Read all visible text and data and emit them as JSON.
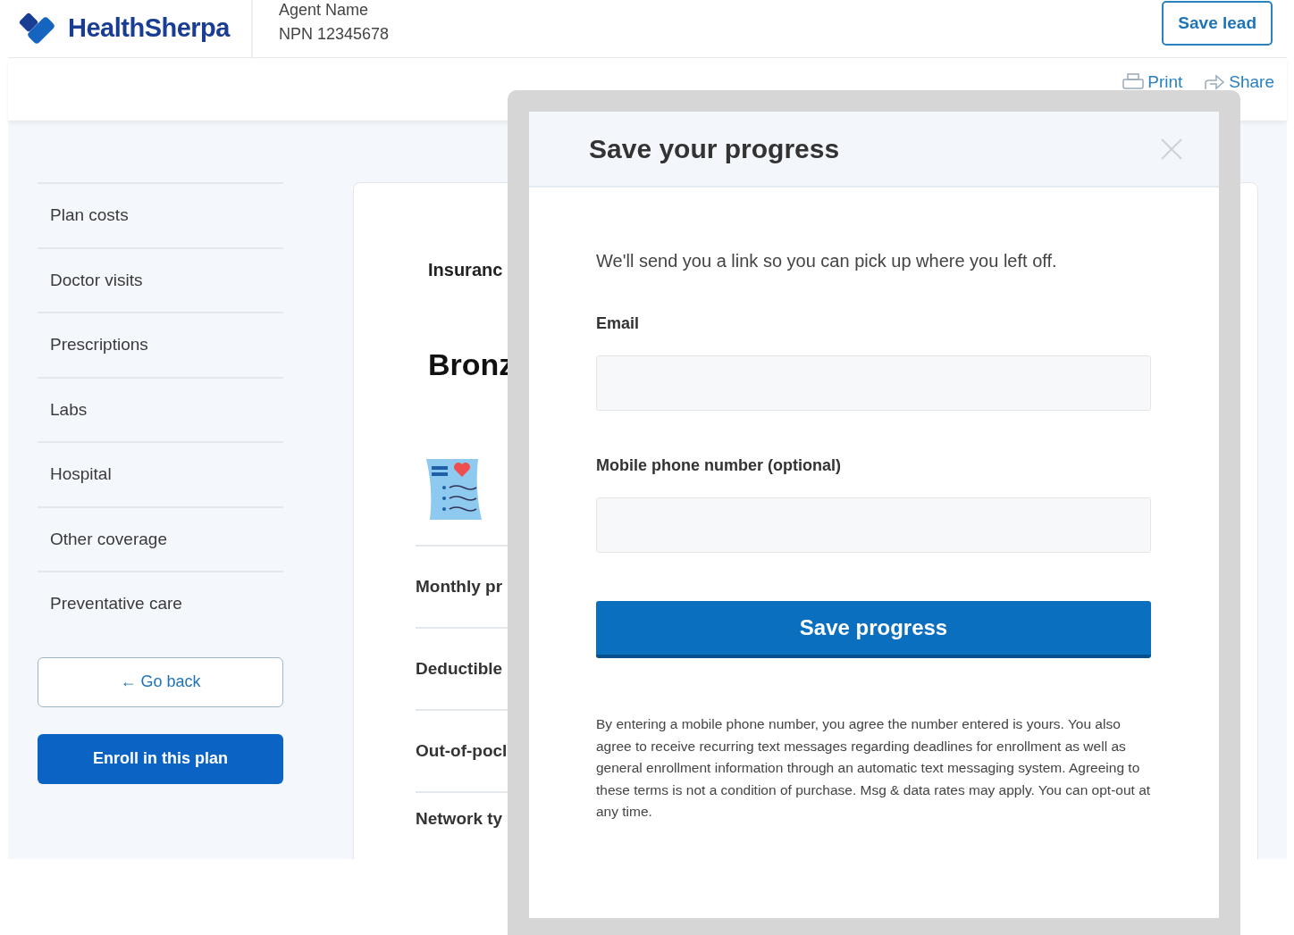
{
  "header": {
    "logo": "HealthSherpa",
    "agent_name": "Agent Name",
    "npn": "NPN 12345678",
    "save_lead_button": "Save lead"
  },
  "toolbar": {
    "print": "Print",
    "share": "Share"
  },
  "sidebar": {
    "items": [
      "Plan costs",
      "Doctor visits",
      "Prescriptions",
      "Labs",
      "Hospital",
      "Other coverage",
      "Preventative care"
    ],
    "go_back_button": "← Go back",
    "enroll_button": "Enroll in this plan"
  },
  "plan_card": {
    "issuer_label": "Insuranc",
    "plan_name": "Bronz",
    "rows": [
      "Monthly pr",
      "Deductible",
      "Out-of-pocl",
      "Network ty"
    ]
  },
  "modal": {
    "title": "Save your progress",
    "intro": "We'll send you a link so you can pick up where you left off.",
    "fields": [
      {
        "label": "Email"
      },
      {
        "label": "Mobile phone number (optional)"
      }
    ],
    "submit_button": "Save progress",
    "disclaimer": "By entering a mobile phone number, you agree the number entered is yours. You also agree to receive recurring text messages regarding deadlines for enrollment as well as general enrollment information through an automatic text messaging system. Agreeing to these terms is not a condition of purchase. Msg & data rates may apply. You can opt-out at any time."
  }
}
